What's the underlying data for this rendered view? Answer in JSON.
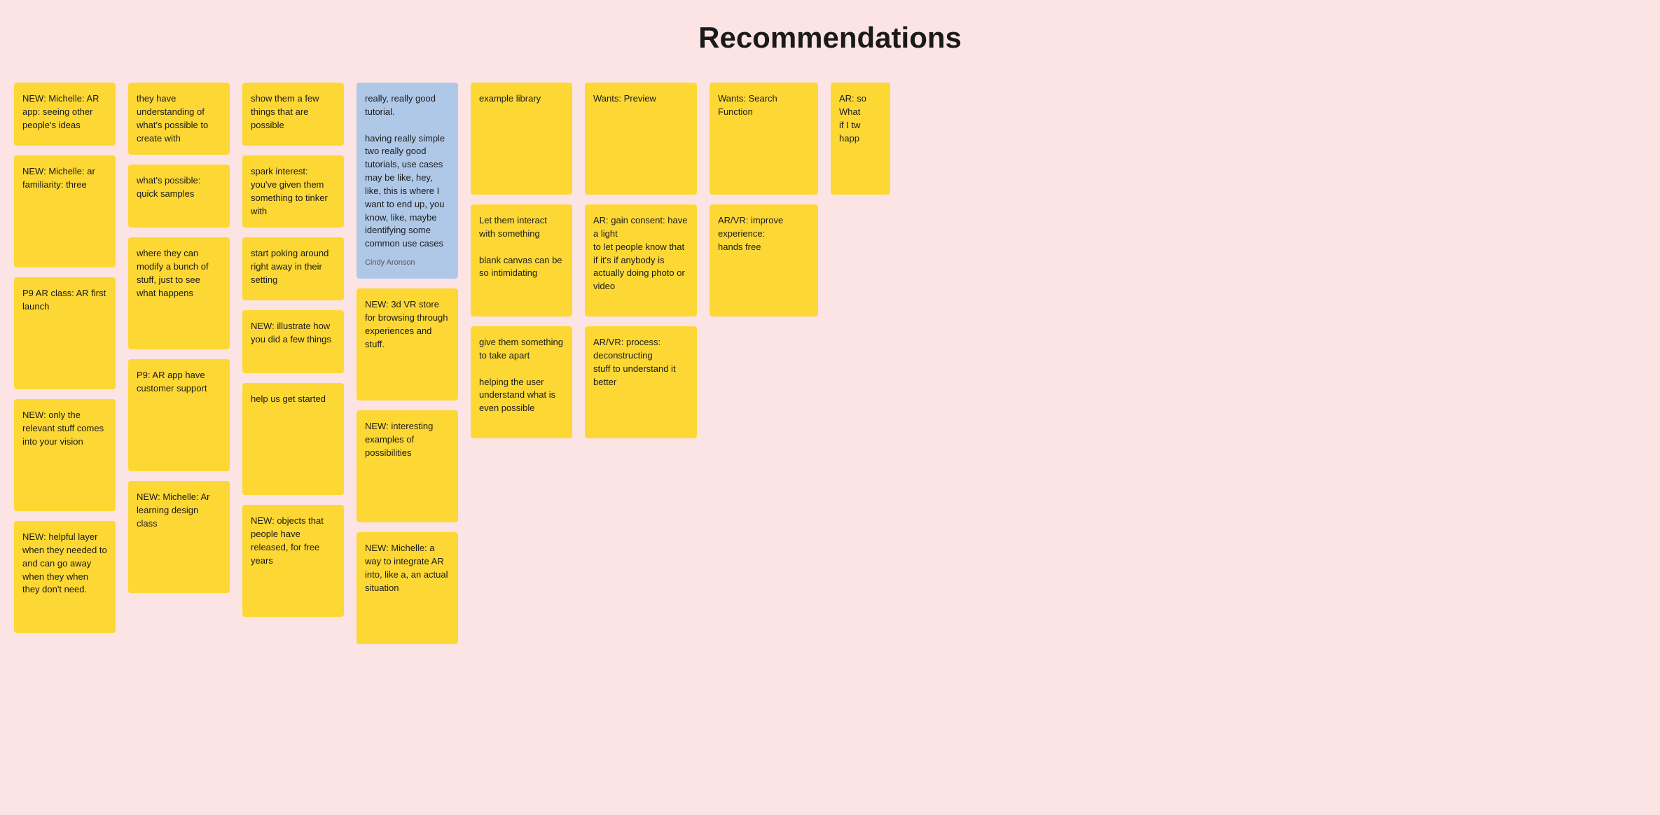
{
  "title": "Recommendations",
  "columns": [
    {
      "id": "col1",
      "cards": [
        {
          "id": "c1-1",
          "text": "NEW: Michelle: AR app: seeing other people's ideas",
          "type": "yellow",
          "height": "normal"
        },
        {
          "id": "c1-2",
          "text": "NEW: Michelle: ar familiarity: three",
          "type": "yellow",
          "height": "tall"
        },
        {
          "id": "c1-3",
          "text": "P9 AR class: AR first launch",
          "type": "yellow",
          "height": "tall"
        },
        {
          "id": "c1-4",
          "text": "NEW: only the relevant stuff comes into your vision",
          "type": "yellow",
          "height": "tall"
        },
        {
          "id": "c1-5",
          "text": "NEW: helpful layer when they needed to and can go away when they when they don't need.",
          "type": "yellow",
          "height": "tall"
        }
      ]
    },
    {
      "id": "col2",
      "cards": [
        {
          "id": "c2-1",
          "text": "they have understanding of what's possible to create with",
          "type": "yellow",
          "height": "normal"
        },
        {
          "id": "c2-2",
          "text": "what's possible: quick samples",
          "type": "yellow",
          "height": "normal"
        },
        {
          "id": "c2-3",
          "text": "where they can modify a bunch of stuff, just to see what happens",
          "type": "yellow",
          "height": "tall"
        },
        {
          "id": "c2-4",
          "text": "P9: AR app have customer support",
          "type": "yellow",
          "height": "tall"
        },
        {
          "id": "c2-5",
          "text": "NEW: Michelle: Ar learning design class",
          "type": "yellow",
          "height": "tall"
        }
      ]
    },
    {
      "id": "col3",
      "cards": [
        {
          "id": "c3-1",
          "text": "show them a few things that are possible",
          "type": "yellow",
          "height": "normal"
        },
        {
          "id": "c3-2",
          "text": "spark interest: you've given them something to tinker with",
          "type": "yellow",
          "height": "normal"
        },
        {
          "id": "c3-3",
          "text": "start poking around right away in their setting",
          "type": "yellow",
          "height": "normal"
        },
        {
          "id": "c3-4",
          "text": "NEW: illustrate how you did a few things",
          "type": "yellow",
          "height": "normal"
        },
        {
          "id": "c3-5",
          "text": "help us get started",
          "type": "yellow",
          "height": "tall"
        },
        {
          "id": "c3-6",
          "text": "NEW: objects that people have released, for free years",
          "type": "yellow",
          "height": "tall"
        }
      ]
    },
    {
      "id": "col4",
      "cards": [
        {
          "id": "c4-1",
          "text": "really, really good tutorial.\n\nhaving really simple two really good tutorials, use cases may be like, hey, like, this is where I want to end up, you know, like, maybe identifying some common use cases",
          "type": "blue",
          "author": "Cindy Aronson",
          "height": "tall"
        },
        {
          "id": "c4-2",
          "text": "NEW: 3d VR store for browsing through experiences and stuff.",
          "type": "yellow",
          "height": "tall"
        },
        {
          "id": "c4-3",
          "text": "NEW: interesting examples of possibilities",
          "type": "yellow",
          "height": "tall"
        },
        {
          "id": "c4-4",
          "text": "NEW: Michelle: a way to integrate AR into, like a, an actual situation",
          "type": "yellow",
          "height": "tall"
        }
      ]
    },
    {
      "id": "col5",
      "cards": [
        {
          "id": "c5-1",
          "text": "example library",
          "type": "yellow",
          "height": "tall"
        },
        {
          "id": "c5-2",
          "text": "Let them interact with something\n\nblank canvas can be so intimidating",
          "type": "yellow",
          "height": "tall"
        },
        {
          "id": "c5-3",
          "text": "give them something to take apart\n\nhelping the user understand what is even possible",
          "type": "yellow",
          "height": "tall"
        }
      ]
    },
    {
      "id": "col6",
      "cards": [
        {
          "id": "c6-1",
          "text": "Wants: Preview",
          "type": "yellow",
          "height": "tall"
        },
        {
          "id": "c6-2",
          "text": "AR: gain consent: have a light\n  to let people know that if it's if anybody is actually doing photo or video",
          "type": "yellow",
          "height": "tall"
        },
        {
          "id": "c6-3",
          "text": "AR/VR: process: deconstructing\n  stuff to understand it better",
          "type": "yellow",
          "height": "tall"
        }
      ]
    },
    {
      "id": "col7",
      "cards": [
        {
          "id": "c7-1",
          "text": "Wants: Search Function",
          "type": "yellow",
          "height": "tall"
        },
        {
          "id": "c7-2",
          "text": "AR/VR: improve experience:\n  hands free",
          "type": "yellow",
          "height": "tall"
        }
      ]
    },
    {
      "id": "col8",
      "cards": [
        {
          "id": "c8-1",
          "text": "AR: so\nWhat\nif I tw\nhapp",
          "type": "yellow",
          "height": "tall"
        }
      ]
    }
  ]
}
